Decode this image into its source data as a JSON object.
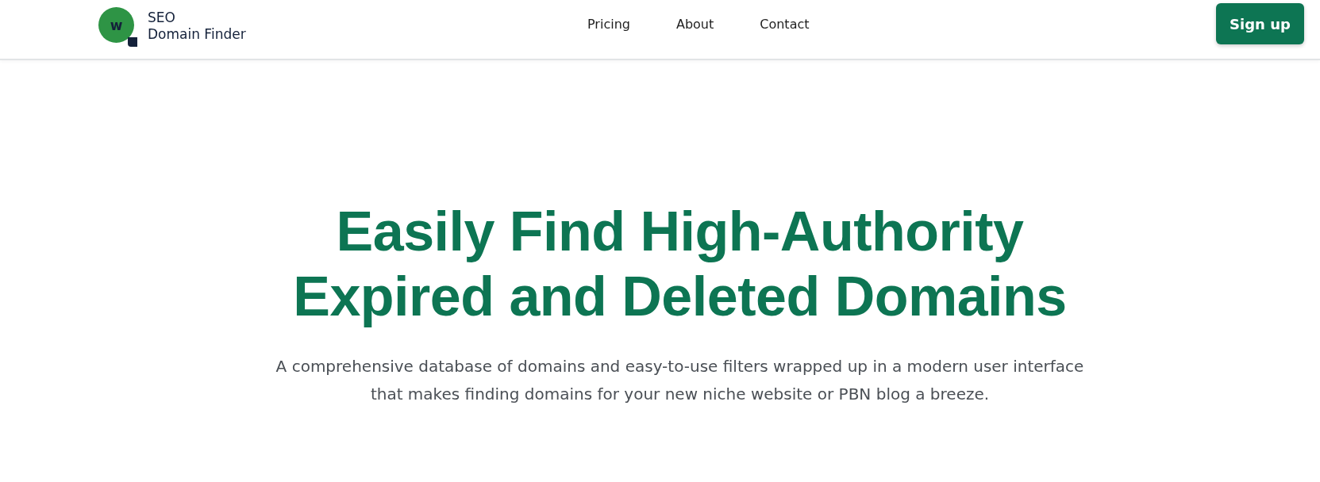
{
  "header": {
    "logo": {
      "badge": "w",
      "line_1": "SEO",
      "line_2": "Domain Finder"
    },
    "nav": [
      "Pricing",
      "About",
      "Contact"
    ],
    "signup_button": "Sign up"
  },
  "hero": {
    "headline_lines": [
      "Easily Find High-Authority",
      "Expired and Deleted Domains"
    ],
    "subtitle_lines": [
      "A comprehensive database of domains and easy-to-use filters wrapped up in a modern user interface",
      "that makes finding domains for your new niche website or PBN blog a breeze."
    ]
  }
}
